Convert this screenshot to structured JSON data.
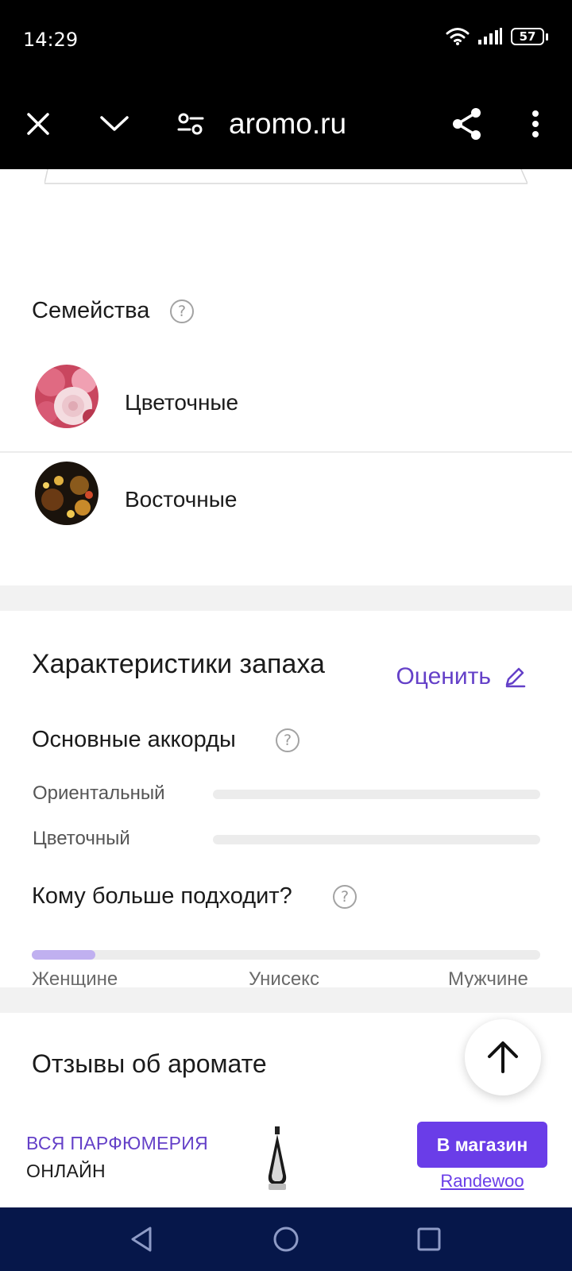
{
  "status_bar": {
    "time": "14:29",
    "battery": "57"
  },
  "browser": {
    "url": "aromo.ru"
  },
  "families": {
    "title": "Семейства",
    "items": [
      {
        "label": "Цветочные"
      },
      {
        "label": "Восточные"
      }
    ]
  },
  "characteristics": {
    "title": "Характеристики запаха",
    "rate_label": "Оценить",
    "accords_title": "Основные аккорды",
    "accords": [
      {
        "label": "Ориентальный",
        "level": 0
      },
      {
        "label": "Цветочный",
        "level": 0
      }
    ],
    "gender_title": "Кому больше подходит?",
    "gender_labels": {
      "women": "Женщине",
      "unisex": "Унисекс",
      "men": "Мужчине"
    },
    "gender_fill_fraction": 0.125
  },
  "reviews": {
    "title": "Отзывы об аромате"
  },
  "ad": {
    "line1": "ВСЯ ПАРФЮМЕРИЯ",
    "line2": "ОНЛАЙН",
    "button_label": "В магазин",
    "shop_name": "Randewoo"
  },
  "colors": {
    "accent": "#6440c8",
    "button": "#6a3de8",
    "nav_bar": "#06174a"
  }
}
